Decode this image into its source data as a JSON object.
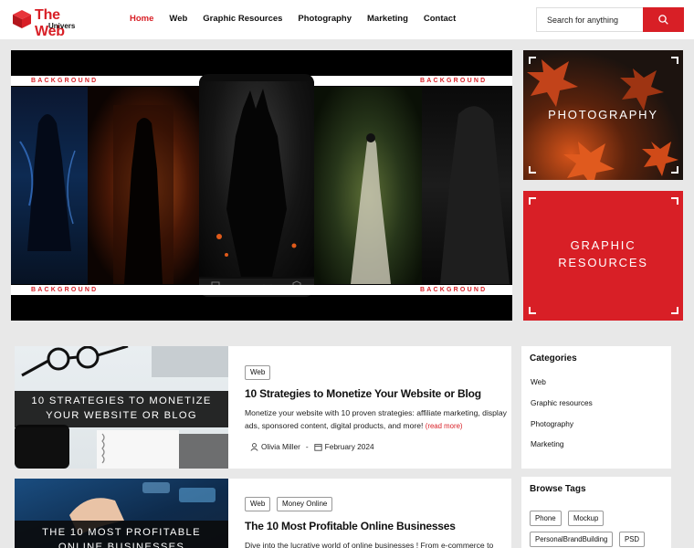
{
  "brand": {
    "name_line1": "The Web",
    "name_line2": "Univers",
    "accent_color": "#d81f26"
  },
  "nav": {
    "items": [
      {
        "label": "Home",
        "active": true
      },
      {
        "label": "Web",
        "active": false
      },
      {
        "label": "Graphic Resources",
        "active": false
      },
      {
        "label": "Photography",
        "active": false
      },
      {
        "label": "Marketing",
        "active": false
      },
      {
        "label": "Contact",
        "active": false
      }
    ]
  },
  "search": {
    "placeholder": "Search for anything",
    "button_icon": "search-icon"
  },
  "hero": {
    "labels": [
      "BACKGROUND",
      "BACKGROUND",
      "BACKGROUND",
      "BACKGROUND"
    ]
  },
  "tiles": {
    "photography": {
      "title": "PHOTOGRAPHY"
    },
    "graphic": {
      "title_line1": "GRAPHIC",
      "title_line2": "RESOURCES"
    }
  },
  "posts": [
    {
      "thumb_line1": "10 STRATEGIES TO MONETIZE",
      "thumb_line2": "YOUR WEBSITE OR BLOG",
      "tags": [
        "Web"
      ],
      "title": "10 Strategies to Monetize Your Website or Blog",
      "excerpt": "Monetize your website with 10 proven strategies: affiliate marketing, display ads, sponsored content, digital products, and more!",
      "read_more": "(read more)",
      "author": "Olivia Miller",
      "date": "February 2024"
    },
    {
      "thumb_line1": "THE 10 MOST PROFITABLE",
      "thumb_line2": "ONLINE BUSINESSES",
      "tags": [
        "Web",
        "Money Online"
      ],
      "title": "The 10 Most Profitable Online Businesses",
      "excerpt": "Dive into the lucrative world of online businesses ! From e-commerce to"
    }
  ],
  "sidebar": {
    "categories": {
      "heading": "Categories",
      "items": [
        "Web",
        "Graphic resources",
        "Photography",
        "Marketing"
      ]
    },
    "tags": {
      "heading": "Browse Tags",
      "items": [
        "Phone",
        "Mockup",
        "PersonalBrandBuilding",
        "PSD"
      ]
    }
  }
}
